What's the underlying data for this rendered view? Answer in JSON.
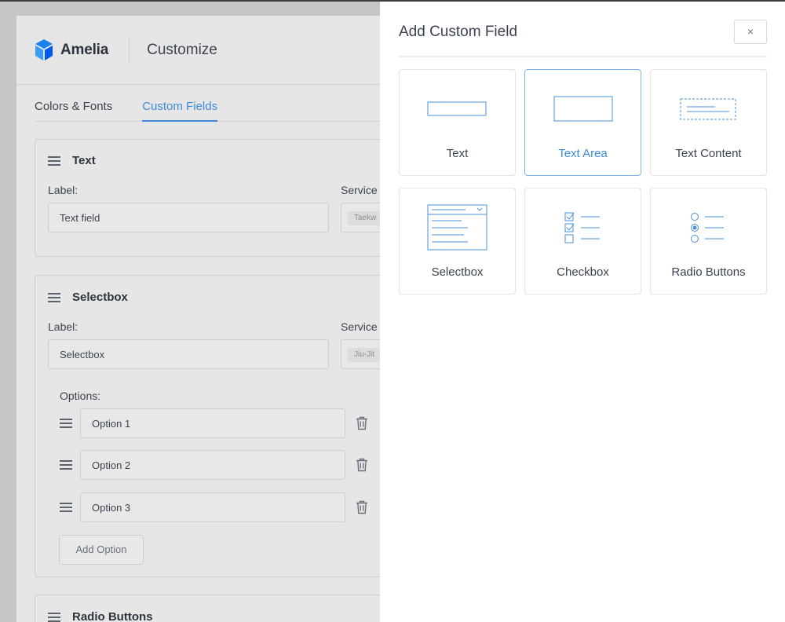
{
  "app": {
    "logo_text": "Amelia",
    "page_title": "Customize",
    "tabs": [
      {
        "label": "Colors & Fonts",
        "active": false
      },
      {
        "label": "Custom Fields",
        "active": true
      }
    ]
  },
  "fields": {
    "text": {
      "title": "Text",
      "label_caption": "Label:",
      "label_value": "Text field",
      "services_caption": "Service",
      "service_tag": "Taekw"
    },
    "selectbox": {
      "title": "Selectbox",
      "label_caption": "Label:",
      "label_value": "Selectbox",
      "services_caption": "Service",
      "service_tag": "Jiu-Jit",
      "options_caption": "Options:",
      "options": [
        "Option 1",
        "Option 2",
        "Option 3"
      ],
      "add_option_label": "Add Option"
    },
    "radio": {
      "title": "Radio Buttons"
    }
  },
  "modal": {
    "title": "Add Custom Field",
    "close_label": "×",
    "types": [
      {
        "label": "Text",
        "icon": "text-input-icon"
      },
      {
        "label": "Text Area",
        "icon": "textarea-icon",
        "selected": true
      },
      {
        "label": "Text Content",
        "icon": "text-content-icon"
      },
      {
        "label": "Selectbox",
        "icon": "selectbox-icon"
      },
      {
        "label": "Checkbox",
        "icon": "checkbox-icon"
      },
      {
        "label": "Radio Buttons",
        "icon": "radio-buttons-icon"
      }
    ]
  },
  "colors": {
    "accent": "#3f8ad8",
    "overlay": "#c6c6c6",
    "panel": "#ffffff"
  }
}
